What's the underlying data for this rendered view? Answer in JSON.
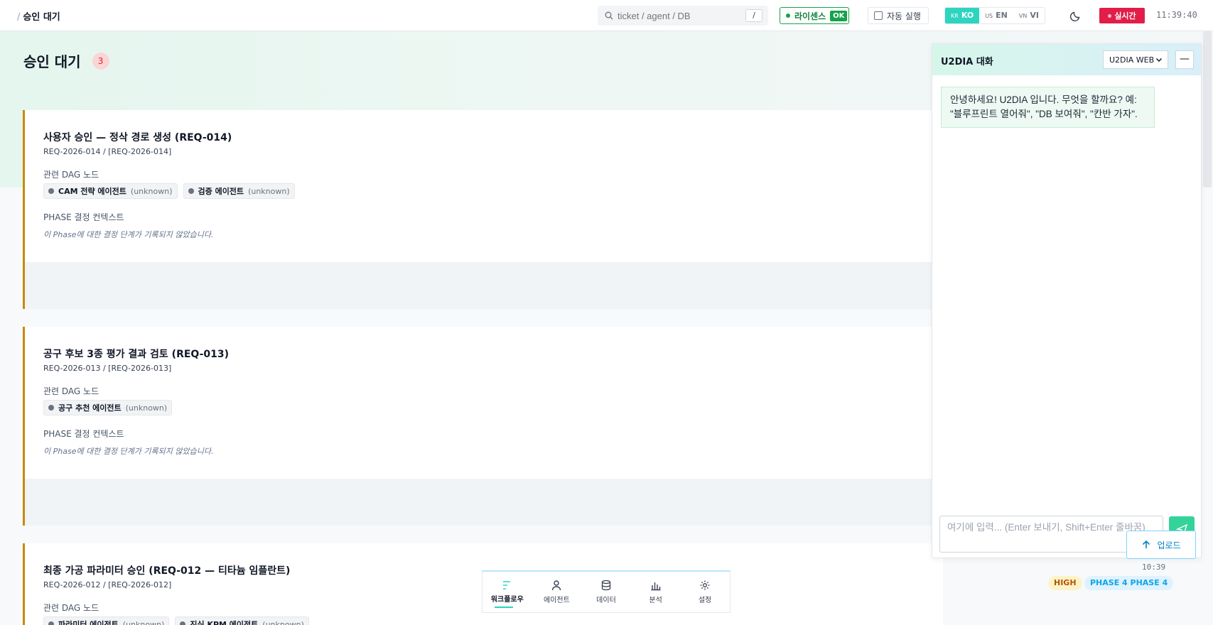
{
  "topbar": {
    "breadcrumb_sep": "/",
    "breadcrumb": "승인 대기",
    "search_placeholder": "ticket / agent / DB",
    "search_shortcut": "/",
    "license_label": "라이센스",
    "license_status": "OK",
    "auto_exec_label": "자동 실행",
    "languages": [
      {
        "flag": "KR",
        "code": "KO",
        "active": true
      },
      {
        "flag": "US",
        "code": "EN",
        "active": false
      },
      {
        "flag": "VN",
        "code": "VI",
        "active": false
      }
    ],
    "theme_icon": "moon-icon",
    "live_label": "실시간",
    "clock": "11:39:40"
  },
  "page": {
    "title": "승인 대기",
    "count": "3"
  },
  "cards": [
    {
      "title": "사용자 승인 — 정삭 경로 생성 (REQ-014)",
      "ids": "REQ-2026-014 / [REQ-2026-014]",
      "dag_label": "관련 DAG 노드",
      "nodes": [
        {
          "name": "CAM 전략 에이전트",
          "state": "(unknown)"
        },
        {
          "name": "검증 에이전트",
          "state": "(unknown)"
        }
      ],
      "phase_label": "PHASE 결정 컨텍스트",
      "phase_note": "이 Phase에 대한 결정 단계가 기록되지 않았습니다."
    },
    {
      "title": "공구 후보 3종 평가 결과 검토 (REQ-013)",
      "ids": "REQ-2026-013 / [REQ-2026-013]",
      "dag_label": "관련 DAG 노드",
      "nodes": [
        {
          "name": "공구 추천 에이전트",
          "state": "(unknown)"
        }
      ],
      "phase_label": "PHASE 결정 컨텍스트",
      "phase_note": "이 Phase에 대한 결정 단계가 기록되지 않았습니다."
    },
    {
      "title": "최종 가공 파라미터 승인 (REQ-012 — 티타늄 임플란트)",
      "ids": "REQ-2026-012 / [REQ-2026-012]",
      "dag_label": "관련 DAG 노드",
      "nodes": [
        {
          "name": "파라미터 에이전트",
          "state": "(unknown)"
        },
        {
          "name": "진실 KPM 에이전트",
          "state": "(unknown)"
        }
      ],
      "time": "10:39",
      "priority": "HIGH",
      "phase_tag": "PHASE 4 PHASE 4"
    }
  ],
  "chat": {
    "title": "U2DIA 대화",
    "channel": "U2DIA WEB",
    "minimize": "—",
    "greeting": "안녕하세요! U2DIA 입니다. 무엇을 할까요? 예: \"블루프린트 열어줘\", \"DB 보여줘\", \"칸반 가자\".",
    "input_placeholder": "여기에 입력... (Enter 보내기, Shift+Enter 줄바꿈)",
    "upload_label": "업로드"
  },
  "bottom_nav": [
    {
      "label": "워크플로우",
      "icon": "workflow-icon",
      "active": true
    },
    {
      "label": "에이전트",
      "icon": "agent-icon",
      "active": false
    },
    {
      "label": "데이터",
      "icon": "database-icon",
      "active": false
    },
    {
      "label": "분석",
      "icon": "chart-icon",
      "active": false
    },
    {
      "label": "설정",
      "icon": "gear-icon",
      "active": false
    }
  ],
  "colors": {
    "accent": "#2dd4bf",
    "live": "#e11d48",
    "license_ok": "#16a34a",
    "card_border": "#ca8a04"
  }
}
